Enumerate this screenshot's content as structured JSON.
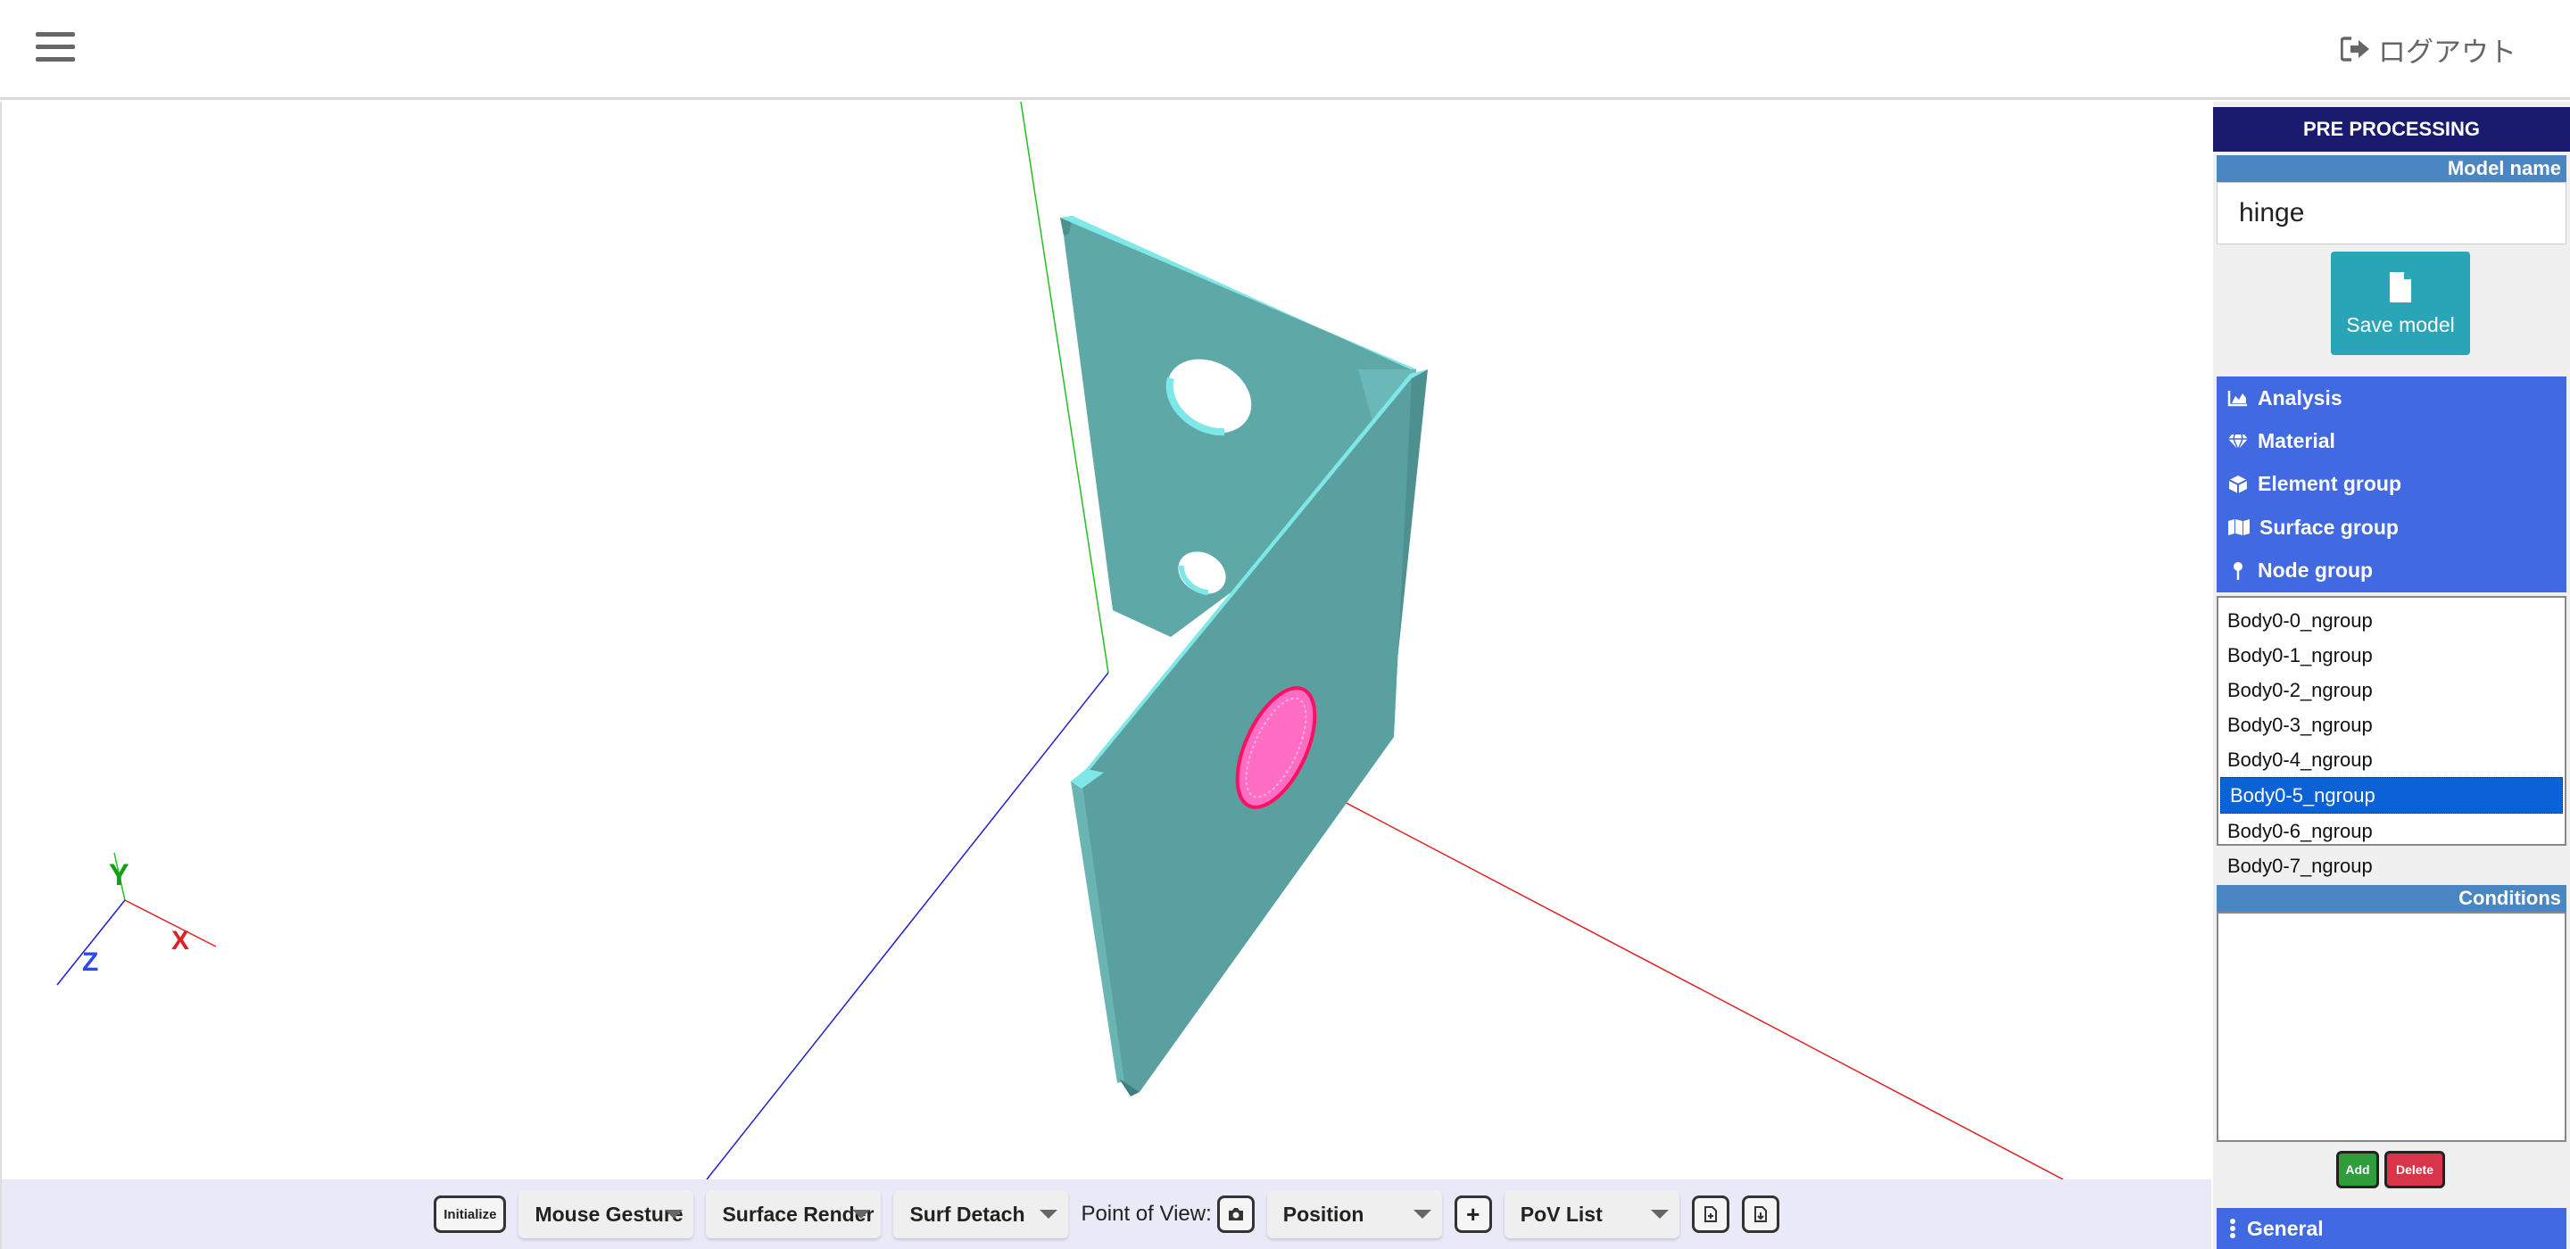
{
  "header": {
    "menu_icon": "hamburger-icon",
    "logout_icon": "sign-out-icon",
    "logout_label": "ログアウト"
  },
  "viewport": {
    "axes": {
      "y_label": "Y",
      "x_label": "X",
      "z_label": "Z"
    },
    "colors": {
      "model": "#5fa8a8",
      "model_edge": "#7ee8e8",
      "highlight": "#ff3fae",
      "x_axis": "#e02020",
      "y_axis": "#20a020",
      "z_axis": "#2020d0"
    }
  },
  "toolbar": {
    "initialize_label": "Initialize",
    "mouse_gesture": "Mouse Gesture",
    "surface_render": "Surface Render",
    "surf_detach": "Surf Detach",
    "pov_label": "Point of View:",
    "position": "Position",
    "plus_label": "+",
    "pov_list": "PoV List"
  },
  "panel": {
    "title": "PRE PROCESSING",
    "model_name_label": "Model name",
    "model_name_value": "hinge",
    "save_label": "Save model",
    "menu": [
      {
        "label": "Analysis",
        "icon": "chart-area-icon"
      },
      {
        "label": "Material",
        "icon": "gem-icon"
      },
      {
        "label": "Element group",
        "icon": "cube-icon"
      },
      {
        "label": "Surface group",
        "icon": "map-icon"
      },
      {
        "label": "Node group",
        "icon": "map-pin-icon"
      }
    ],
    "node_groups": [
      "Body0-0_ngroup",
      "Body0-1_ngroup",
      "Body0-2_ngroup",
      "Body0-3_ngroup",
      "Body0-4_ngroup",
      "Body0-5_ngroup",
      "Body0-6_ngroup",
      "Body0-7_ngroup"
    ],
    "selected_node_group": "Body0-5_ngroup",
    "conditions_label": "Conditions",
    "add_label": "Add",
    "delete_label": "Delete",
    "general_label": "General"
  }
}
